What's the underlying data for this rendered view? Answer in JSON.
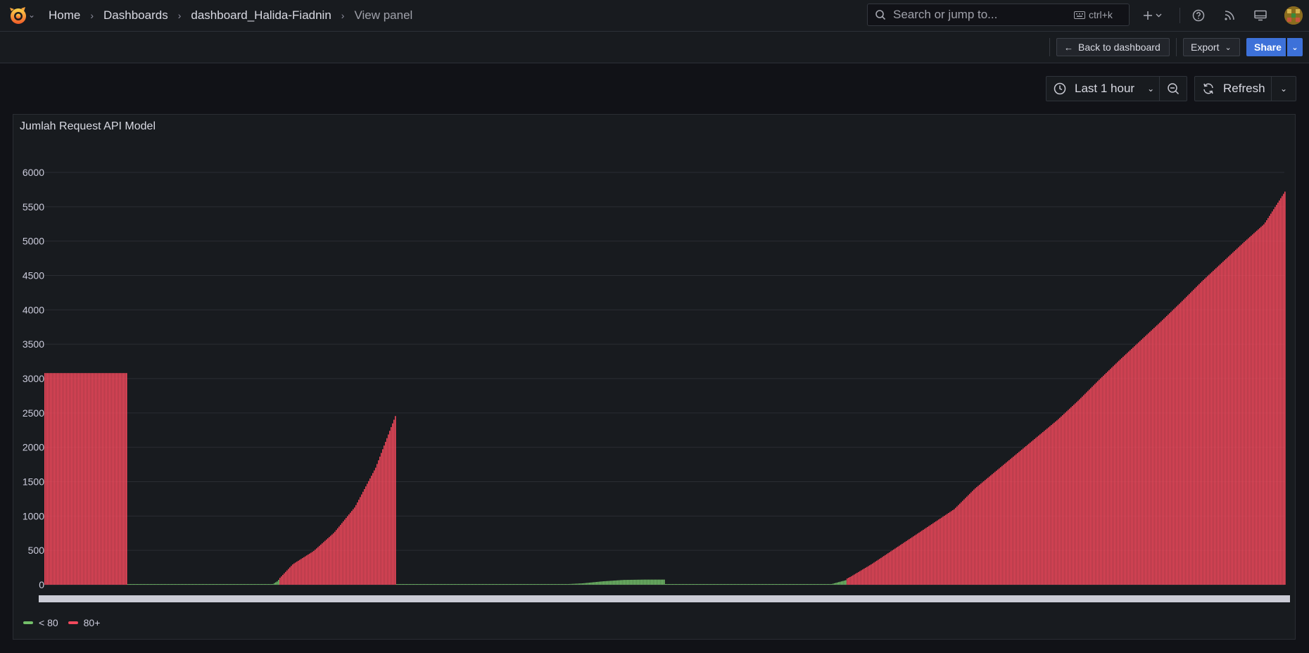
{
  "breadcrumb": {
    "home": "Home",
    "dashboards": "Dashboards",
    "dashboard": "dashboard_Halida-Fiadnin",
    "current": "View panel"
  },
  "search": {
    "placeholder": "Search or jump to...",
    "shortcut": "ctrl+k"
  },
  "toolbar": {
    "back_label": "Back to dashboard",
    "export_label": "Export",
    "share_label": "Share"
  },
  "time_picker": {
    "range_label": "Last 1 hour",
    "refresh_label": "Refresh"
  },
  "colors": {
    "series_low": "#73bf69",
    "series_high": "#f2495c",
    "accent": "#3d71d9"
  },
  "icons": {
    "logo": "grafana-logo-icon",
    "search": "search-icon",
    "keyboard": "keyboard-icon",
    "add": "plus-icon",
    "help": "help-icon",
    "news": "rss-icon",
    "kiosk": "monitor-icon",
    "clock": "clock-icon",
    "zoom_out": "zoom-out-icon",
    "refresh": "refresh-icon"
  },
  "panel": {
    "title": "Jumlah Request API Model"
  },
  "chart_data": {
    "type": "bar",
    "title": "Jumlah Request API Model",
    "xlabel": "",
    "ylabel": "",
    "ylim": [
      0,
      6000
    ],
    "yticks": [
      "0",
      "500",
      "1000",
      "1500",
      "2000",
      "2500",
      "3000",
      "3500",
      "4000",
      "4500",
      "5000",
      "5500",
      "6000"
    ],
    "grid": true,
    "legend_position": "bottom-left",
    "threshold": 80,
    "series": [
      {
        "name": "< 80",
        "color": "#73bf69"
      },
      {
        "name": "80+",
        "color": "#f2495c"
      }
    ],
    "x_index": [
      0,
      1,
      2,
      3,
      3.99,
      4,
      5,
      6,
      7,
      8,
      9,
      10,
      11,
      11.3,
      11.31,
      12,
      13,
      14,
      15,
      16,
      16.99,
      17,
      18,
      19,
      20,
      21,
      22,
      23,
      24,
      25,
      26,
      27,
      28,
      29,
      29.99,
      30,
      31,
      32,
      33,
      34,
      35,
      36,
      37,
      38,
      38.8,
      38.81,
      39,
      40,
      41,
      42,
      43,
      44,
      45,
      46,
      47,
      48,
      49,
      50,
      51,
      52,
      53,
      54,
      55,
      56,
      57,
      58,
      59,
      60
    ],
    "values": [
      3080,
      3080,
      3080,
      3080,
      3080,
      5,
      5,
      5,
      5,
      5,
      5,
      5,
      5,
      60,
      80,
      300,
      490,
      760,
      1130,
      1700,
      2480,
      5,
      5,
      5,
      5,
      5,
      5,
      5,
      5,
      5,
      20,
      50,
      70,
      75,
      75,
      5,
      5,
      5,
      5,
      5,
      5,
      5,
      5,
      5,
      70,
      90,
      120,
      300,
      500,
      700,
      900,
      1100,
      1400,
      1650,
      1900,
      2150,
      2400,
      2680,
      2980,
      3270,
      3550,
      3830,
      4120,
      4420,
      4700,
      4980,
      5250,
      5720
    ]
  }
}
